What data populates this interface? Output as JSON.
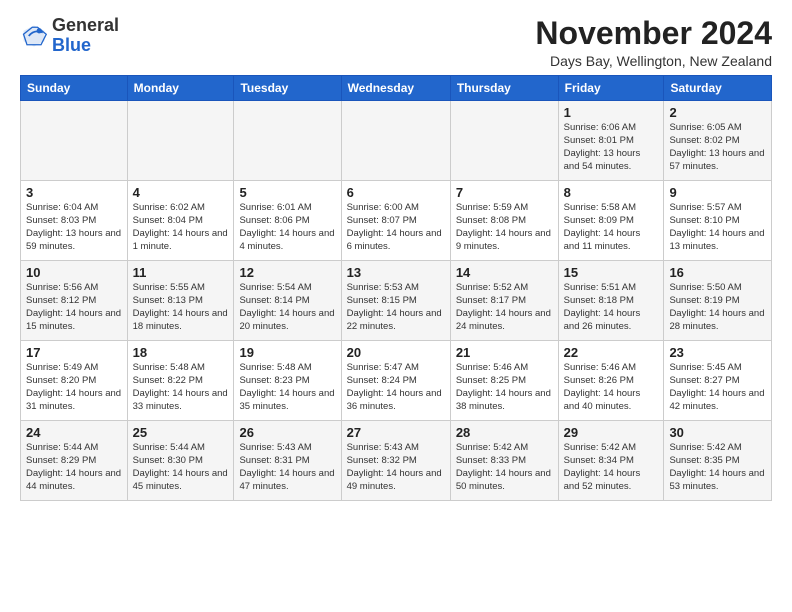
{
  "header": {
    "logo_general": "General",
    "logo_blue": "Blue",
    "month_title": "November 2024",
    "location": "Days Bay, Wellington, New Zealand"
  },
  "weekdays": [
    "Sunday",
    "Monday",
    "Tuesday",
    "Wednesday",
    "Thursday",
    "Friday",
    "Saturday"
  ],
  "weeks": [
    [
      {
        "day": "",
        "info": ""
      },
      {
        "day": "",
        "info": ""
      },
      {
        "day": "",
        "info": ""
      },
      {
        "day": "",
        "info": ""
      },
      {
        "day": "",
        "info": ""
      },
      {
        "day": "1",
        "info": "Sunrise: 6:06 AM\nSunset: 8:01 PM\nDaylight: 13 hours\nand 54 minutes."
      },
      {
        "day": "2",
        "info": "Sunrise: 6:05 AM\nSunset: 8:02 PM\nDaylight: 13 hours\nand 57 minutes."
      }
    ],
    [
      {
        "day": "3",
        "info": "Sunrise: 6:04 AM\nSunset: 8:03 PM\nDaylight: 13 hours\nand 59 minutes."
      },
      {
        "day": "4",
        "info": "Sunrise: 6:02 AM\nSunset: 8:04 PM\nDaylight: 14 hours\nand 1 minute."
      },
      {
        "day": "5",
        "info": "Sunrise: 6:01 AM\nSunset: 8:06 PM\nDaylight: 14 hours\nand 4 minutes."
      },
      {
        "day": "6",
        "info": "Sunrise: 6:00 AM\nSunset: 8:07 PM\nDaylight: 14 hours\nand 6 minutes."
      },
      {
        "day": "7",
        "info": "Sunrise: 5:59 AM\nSunset: 8:08 PM\nDaylight: 14 hours\nand 9 minutes."
      },
      {
        "day": "8",
        "info": "Sunrise: 5:58 AM\nSunset: 8:09 PM\nDaylight: 14 hours\nand 11 minutes."
      },
      {
        "day": "9",
        "info": "Sunrise: 5:57 AM\nSunset: 8:10 PM\nDaylight: 14 hours\nand 13 minutes."
      }
    ],
    [
      {
        "day": "10",
        "info": "Sunrise: 5:56 AM\nSunset: 8:12 PM\nDaylight: 14 hours\nand 15 minutes."
      },
      {
        "day": "11",
        "info": "Sunrise: 5:55 AM\nSunset: 8:13 PM\nDaylight: 14 hours\nand 18 minutes."
      },
      {
        "day": "12",
        "info": "Sunrise: 5:54 AM\nSunset: 8:14 PM\nDaylight: 14 hours\nand 20 minutes."
      },
      {
        "day": "13",
        "info": "Sunrise: 5:53 AM\nSunset: 8:15 PM\nDaylight: 14 hours\nand 22 minutes."
      },
      {
        "day": "14",
        "info": "Sunrise: 5:52 AM\nSunset: 8:17 PM\nDaylight: 14 hours\nand 24 minutes."
      },
      {
        "day": "15",
        "info": "Sunrise: 5:51 AM\nSunset: 8:18 PM\nDaylight: 14 hours\nand 26 minutes."
      },
      {
        "day": "16",
        "info": "Sunrise: 5:50 AM\nSunset: 8:19 PM\nDaylight: 14 hours\nand 28 minutes."
      }
    ],
    [
      {
        "day": "17",
        "info": "Sunrise: 5:49 AM\nSunset: 8:20 PM\nDaylight: 14 hours\nand 31 minutes."
      },
      {
        "day": "18",
        "info": "Sunrise: 5:48 AM\nSunset: 8:22 PM\nDaylight: 14 hours\nand 33 minutes."
      },
      {
        "day": "19",
        "info": "Sunrise: 5:48 AM\nSunset: 8:23 PM\nDaylight: 14 hours\nand 35 minutes."
      },
      {
        "day": "20",
        "info": "Sunrise: 5:47 AM\nSunset: 8:24 PM\nDaylight: 14 hours\nand 36 minutes."
      },
      {
        "day": "21",
        "info": "Sunrise: 5:46 AM\nSunset: 8:25 PM\nDaylight: 14 hours\nand 38 minutes."
      },
      {
        "day": "22",
        "info": "Sunrise: 5:46 AM\nSunset: 8:26 PM\nDaylight: 14 hours\nand 40 minutes."
      },
      {
        "day": "23",
        "info": "Sunrise: 5:45 AM\nSunset: 8:27 PM\nDaylight: 14 hours\nand 42 minutes."
      }
    ],
    [
      {
        "day": "24",
        "info": "Sunrise: 5:44 AM\nSunset: 8:29 PM\nDaylight: 14 hours\nand 44 minutes."
      },
      {
        "day": "25",
        "info": "Sunrise: 5:44 AM\nSunset: 8:30 PM\nDaylight: 14 hours\nand 45 minutes."
      },
      {
        "day": "26",
        "info": "Sunrise: 5:43 AM\nSunset: 8:31 PM\nDaylight: 14 hours\nand 47 minutes."
      },
      {
        "day": "27",
        "info": "Sunrise: 5:43 AM\nSunset: 8:32 PM\nDaylight: 14 hours\nand 49 minutes."
      },
      {
        "day": "28",
        "info": "Sunrise: 5:42 AM\nSunset: 8:33 PM\nDaylight: 14 hours\nand 50 minutes."
      },
      {
        "day": "29",
        "info": "Sunrise: 5:42 AM\nSunset: 8:34 PM\nDaylight: 14 hours\nand 52 minutes."
      },
      {
        "day": "30",
        "info": "Sunrise: 5:42 AM\nSunset: 8:35 PM\nDaylight: 14 hours\nand 53 minutes."
      }
    ]
  ]
}
